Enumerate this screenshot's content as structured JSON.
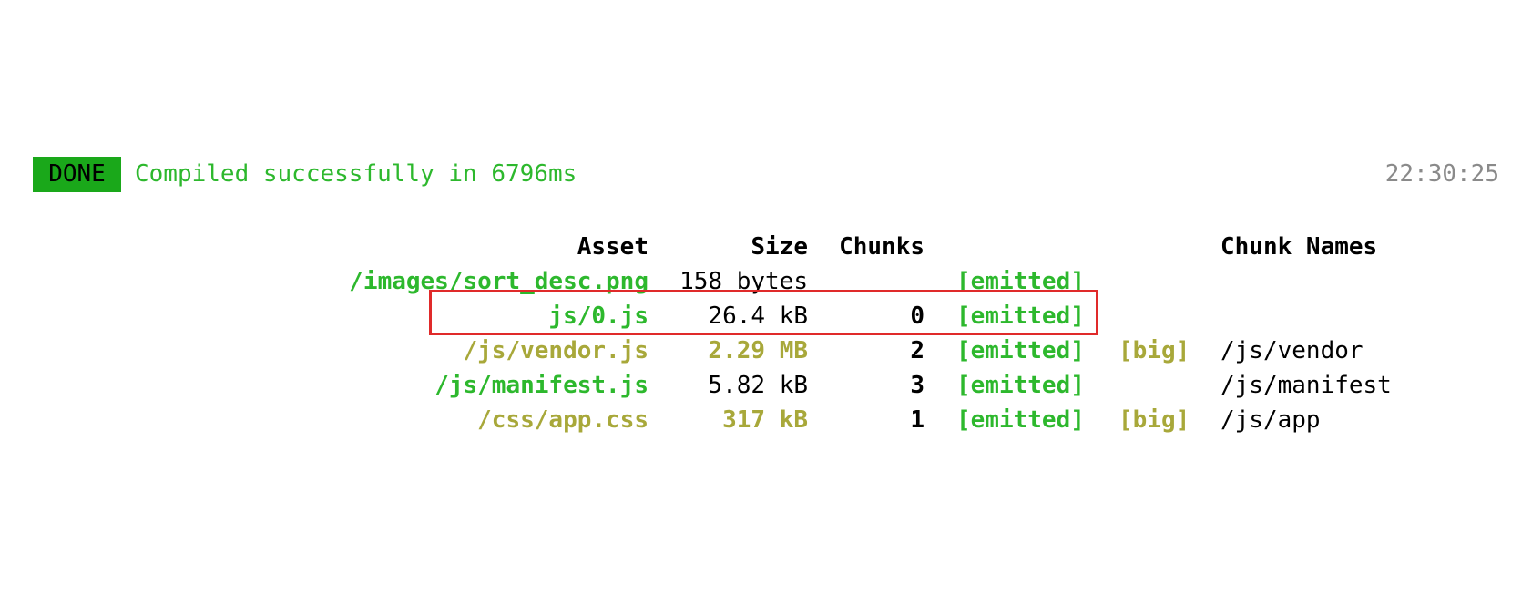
{
  "status": {
    "badge": "DONE",
    "message": "Compiled successfully in 6796ms",
    "time": "22:30:25",
    "badge_color": "#1aa81a",
    "message_color": "#2db82d"
  },
  "table": {
    "headers": {
      "asset": "Asset",
      "size": "Size",
      "chunks": "Chunks",
      "chunk_names": "Chunk Names"
    },
    "rows": [
      {
        "asset": "/images/sort_desc.png",
        "size": "158 bytes",
        "chunks": "",
        "status": "[emitted]",
        "flag": "",
        "chunk_name": "",
        "asset_color": "green",
        "size_color": "default"
      },
      {
        "asset": "js/0.js",
        "size": "26.4 kB",
        "chunks": "0",
        "status": "[emitted]",
        "flag": "",
        "chunk_name": "",
        "asset_color": "green",
        "size_color": "default"
      },
      {
        "asset": "/js/vendor.js",
        "size": "2.29 MB",
        "chunks": "2",
        "status": "[emitted]",
        "flag": "[big]",
        "chunk_name": "/js/vendor",
        "asset_color": "yellow",
        "size_color": "yellow"
      },
      {
        "asset": "/js/manifest.js",
        "size": "5.82 kB",
        "chunks": "3",
        "status": "[emitted]",
        "flag": "",
        "chunk_name": "/js/manifest",
        "asset_color": "green",
        "size_color": "default"
      },
      {
        "asset": "/css/app.css",
        "size": "317 kB",
        "chunks": "1",
        "status": "[emitted]",
        "flag": "[big]",
        "chunk_name": "/js/app",
        "asset_color": "yellow",
        "size_color": "yellow"
      }
    ]
  },
  "colors": {
    "green": "#2db82d",
    "yellow": "#a8a83a",
    "highlight": "#e02a2a",
    "timestamp": "#8a8a8a"
  }
}
